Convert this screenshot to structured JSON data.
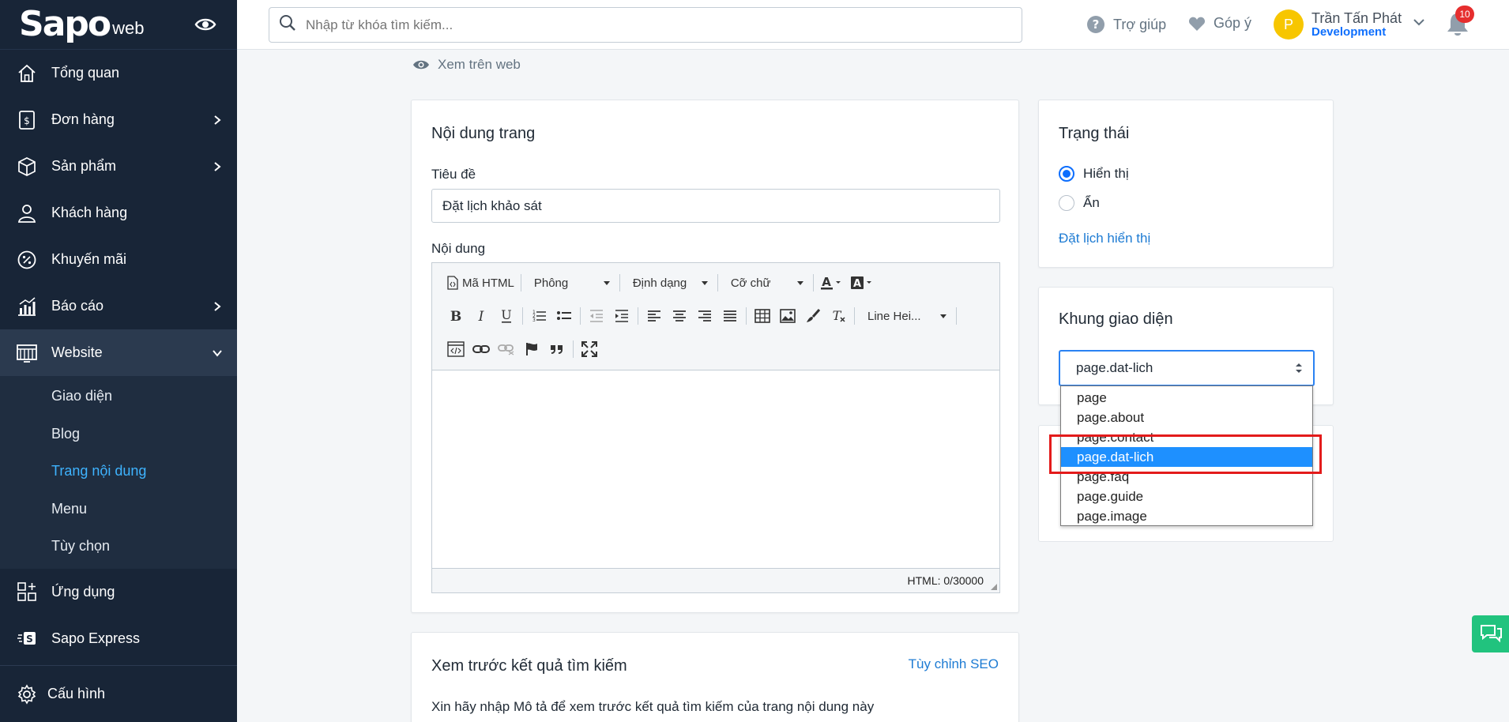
{
  "brand": {
    "logo": "Sapo",
    "logo_suffix": "web"
  },
  "sidebar": {
    "items": [
      {
        "label": "Tổng quan",
        "icon": "home-icon"
      },
      {
        "label": "Đơn hàng",
        "icon": "order-icon",
        "has_children": true
      },
      {
        "label": "Sản phẩm",
        "icon": "box-icon",
        "has_children": true
      },
      {
        "label": "Khách hàng",
        "icon": "user-icon"
      },
      {
        "label": "Khuyến mãi",
        "icon": "percent-icon"
      },
      {
        "label": "Báo cáo",
        "icon": "chart-icon",
        "has_children": true
      },
      {
        "label": "Website",
        "icon": "website-icon",
        "expanded": true
      }
    ],
    "website_sub": [
      "Giao diện",
      "Blog",
      "Trang nội dung",
      "Menu",
      "Tùy chọn"
    ],
    "current_sub": "Trang nội dung",
    "after_items": [
      {
        "label": "Ứng dụng",
        "icon": "apps-icon"
      },
      {
        "label": "Sapo Express",
        "icon": "sapo-express-icon"
      }
    ],
    "settings_label": "Cấu hình"
  },
  "header": {
    "search_placeholder": "Nhập từ khóa tìm kiếm...",
    "help_label": "Trợ giúp",
    "feedback_label": "Góp ý",
    "user_initial": "P",
    "user_name": "Trần Tấn Phát",
    "user_role": "Development",
    "notification_count": "10"
  },
  "main": {
    "view_on_web": "Xem trên web",
    "content_card": {
      "title": "Nội dung trang",
      "title_label": "Tiêu đề",
      "title_value": "Đặt lịch khảo sát",
      "content_label": "Nội dung",
      "toolbar": {
        "html_btn": "Mã HTML",
        "font_drop": "Phông",
        "format_drop": "Định dạng",
        "size_drop": "Cỡ chữ",
        "line_height_drop": "Line Hei..."
      },
      "html_counter": "HTML: 0/30000"
    },
    "status_card": {
      "title": "Trạng thái",
      "options": [
        "Hiển thị",
        "Ẩn"
      ],
      "selected": "Hiển thị",
      "schedule_link": "Đặt lịch hiển thị"
    },
    "template_card": {
      "title": "Khung giao diện",
      "selected_value": "page.dat-lich",
      "options": [
        "page",
        "page.about",
        "page.contact",
        "page.dat-lich",
        "page.faq",
        "page.guide",
        "page.image"
      ]
    },
    "seo_card": {
      "title": "Xem trước kết quả tìm kiếm",
      "customize_link": "Tùy chỉnh SEO",
      "description": "Xin hãy nhập Mô tả để xem trước kết quả tìm kiếm của trang nội dung này"
    }
  },
  "colors": {
    "sidebar_bg": "#182537",
    "accent": "#0d6efd",
    "link": "#1d7bd3",
    "active_sub": "#3eb3ff",
    "highlight_box": "#e31b1b",
    "dropdown_selected": "#1e90ff",
    "chat_fab": "#21c37e"
  }
}
